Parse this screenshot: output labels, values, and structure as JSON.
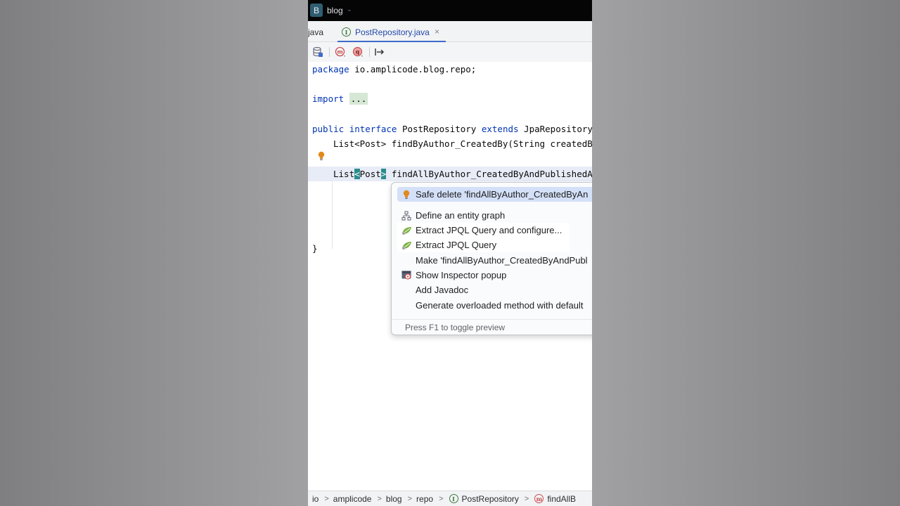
{
  "titlebar": {
    "project_badge": "B",
    "project_name": "blog",
    "chevron": "⌄"
  },
  "tabs": {
    "previous_label": "java",
    "active": {
      "label": "PostRepository.java",
      "icon": "interface-icon",
      "icon_letter": "I",
      "close": "×"
    }
  },
  "toolbar": {
    "buttons": [
      "database-icon",
      "method-m-icon",
      "query-q-icon",
      "jump-to-icon"
    ],
    "m_letter": "m",
    "q_letter": "q",
    "jump_glyph": "↦"
  },
  "editor": {
    "line1": {
      "kw": "package",
      "rest": " io.amplicode.blog.repo;"
    },
    "line2": {
      "kw": "import",
      "fold": "..."
    },
    "line3": {
      "kw1": "public",
      "kw2": "interface",
      "name": " PostRepository ",
      "kw3": "extends",
      "rest": " JpaRepository"
    },
    "line4": "List<Post> findByAuthor_CreatedBy(String createdB",
    "line5": {
      "list": "List",
      "lt": "<",
      "post": "Post",
      "gt": ">",
      "method": "findAllByAuthor_CreatedByAndPublishedA"
    },
    "line6": "}"
  },
  "popup": {
    "items": [
      {
        "label": "Safe delete 'findAllByAuthor_CreatedByAn",
        "icon": "bulb-icon"
      },
      {
        "label": "Define an entity graph",
        "icon": "entity-graph-icon"
      },
      {
        "label": "Extract JPQL Query and configure...",
        "icon": "jpa-leaf-icon"
      },
      {
        "label": "Extract JPQL Query",
        "icon": "jpa-leaf-icon"
      },
      {
        "label": "Make 'findAllByAuthor_CreatedByAndPubl",
        "icon": ""
      },
      {
        "label": "Show Inspector popup",
        "icon": "inspector-icon"
      },
      {
        "label": "Add Javadoc",
        "icon": ""
      },
      {
        "label": "Generate overloaded method with default",
        "icon": ""
      }
    ],
    "footer": "Press F1 to toggle preview"
  },
  "breadcrumb": {
    "items": [
      "io",
      "amplicode",
      "blog",
      "repo",
      "PostRepository",
      "findAllB"
    ],
    "separator": ">",
    "interface_letter": "I",
    "method_letter": "m"
  },
  "colors": {
    "keyword": "#0033b3",
    "selection": "#d4e0f7",
    "accent": "#3d6ccc",
    "brace_match": "#2b8c8c"
  }
}
